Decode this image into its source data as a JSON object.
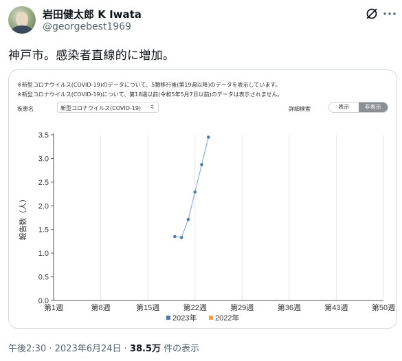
{
  "tweet": {
    "author_name": "岩田健太郎 K Iwata",
    "author_handle": "@georgebest1969",
    "text": "神戸市。感染者直線的に増加。",
    "icons": {
      "grok": "grok-icon",
      "more": "more-dots-icon"
    }
  },
  "card": {
    "notice_1": "※新型コロナウイルス(COVID-19)のデータについて、5類移行後(第19週以降)のデータを表示しています。",
    "notice_2": "※新型コロナウイルス(COVID-19)について、第18週以前(令和5年5月7日以前)のデータは表示されません。",
    "disease_label": "疾患名",
    "disease_value": "新型コロナウイルス(COVID-19)",
    "disease_arrow": "⇕",
    "detail_label": "詳細検索",
    "toggle_show": "表示",
    "toggle_hide": "非表示"
  },
  "chart_data": {
    "type": "line",
    "ylabel": "報告数（人）",
    "ylim": [
      0,
      3.5
    ],
    "y_ticks": [
      "0.0",
      "0.5",
      "1.0",
      "1.5",
      "2.0",
      "2.5",
      "3.0",
      "3.5"
    ],
    "xlim": [
      1,
      50
    ],
    "x_ticks": [
      1,
      8,
      15,
      22,
      29,
      36,
      43,
      50
    ],
    "x_tick_labels": [
      "第1週",
      "第8週",
      "第15週",
      "第22週",
      "第29週",
      "第36週",
      "第43週",
      "第50週"
    ],
    "grid": "vertical",
    "legend_placement": "bottom",
    "series": [
      {
        "name": "2023年",
        "color": "#4d7aab",
        "x": [
          19,
          20,
          21,
          22,
          23,
          24
        ],
        "y": [
          1.35,
          1.33,
          1.71,
          2.29,
          2.87,
          3.45
        ]
      },
      {
        "name": "2022年",
        "color": "#f0a04b",
        "x": [],
        "y": []
      }
    ]
  },
  "footer": {
    "time": "午後2:30",
    "separator_1": "·",
    "date": "2023年6月24日",
    "separator_2": "·",
    "views_count": "38.5万",
    "views_label": "件の表示"
  }
}
